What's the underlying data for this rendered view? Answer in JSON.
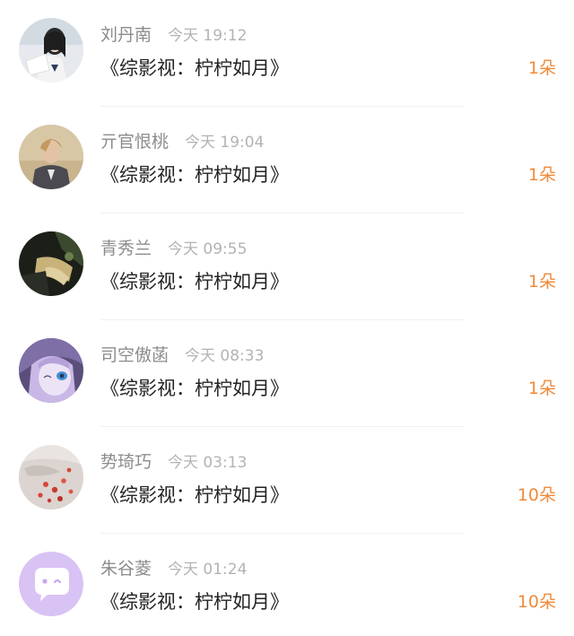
{
  "items": [
    {
      "name": "刘丹南",
      "time": "今天 19:12",
      "title": "《综影视：柠柠如月》",
      "count": "1朵",
      "avatar": "photo-avatar"
    },
    {
      "name": "亓官恨桃",
      "time": "今天 19:04",
      "title": "《综影视：柠柠如月》",
      "count": "1朵",
      "avatar": "photo-avatar"
    },
    {
      "name": "青秀兰",
      "time": "今天 09:55",
      "title": "《综影视：柠柠如月》",
      "count": "1朵",
      "avatar": "photo-avatar"
    },
    {
      "name": "司空傲菡",
      "time": "今天 08:33",
      "title": "《综影视：柠柠如月》",
      "count": "1朵",
      "avatar": "anime-avatar"
    },
    {
      "name": "势琦巧",
      "time": "今天 03:13",
      "title": "《综影视：柠柠如月》",
      "count": "10朵",
      "avatar": "photo-avatar"
    },
    {
      "name": "朱谷菱",
      "time": "今天 01:24",
      "title": "《综影视：柠柠如月》",
      "count": "10朵",
      "avatar": "chat-bubble-icon"
    }
  ]
}
